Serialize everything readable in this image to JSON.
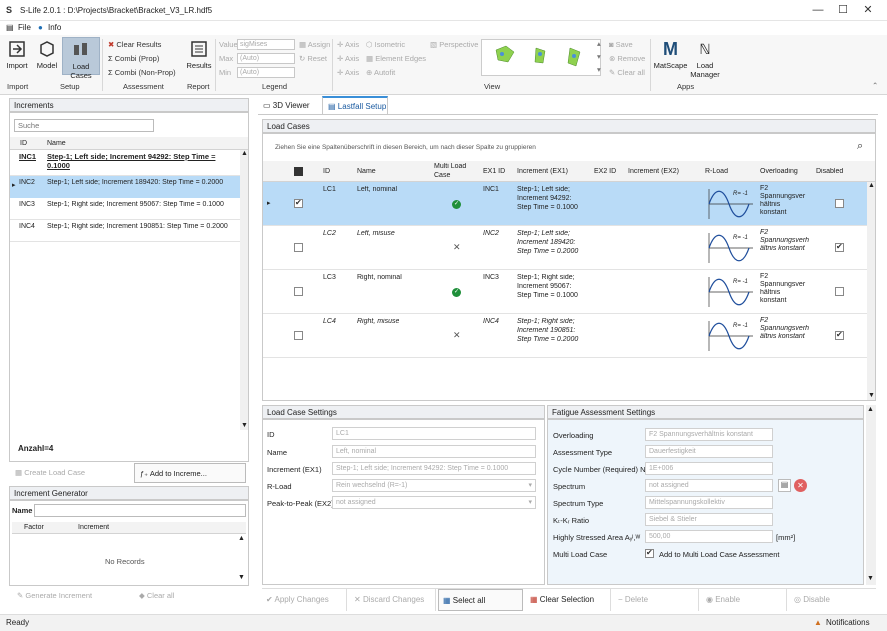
{
  "window": {
    "title": "S-Life 2.0.1 : D:\\Projects\\Bracket\\Bracket_V3_LR.hdf5",
    "app_icon": "S"
  },
  "menu": {
    "file": "File",
    "info": "Info"
  },
  "ribbon": {
    "import": "Import",
    "model": "Model",
    "load_cases": "Load Cases",
    "clear_results": "Clear Results",
    "combi_prop": "Combi (Prop)",
    "combi_nonprop": "Combi (Non-Prop)",
    "results": "Results",
    "value_label": "Value",
    "value_val": "sigMises",
    "max_label": "Max",
    "max_val": "(Auto)",
    "min_label": "Min",
    "min_val": "(Auto)",
    "assign": "Assign",
    "reset": "Reset",
    "axis1": "Axis",
    "isometric": "Isometric",
    "axis2": "Axis",
    "element_edges": "Element Edges",
    "axis3": "Axis",
    "autofit": "Autofit",
    "perspective": "Perspective",
    "save": "Save",
    "remove": "Remove",
    "clear_all": "Clear all",
    "matscape": "MatScape",
    "load_manager": "Load Manager",
    "groups": {
      "import": "Import",
      "setup": "Setup",
      "assessment": "Assessment",
      "report": "Report",
      "legend": "Legend",
      "view": "View",
      "apps": "Apps"
    }
  },
  "increments": {
    "title": "Increments",
    "search_placeholder": "Suche",
    "col_id": "ID",
    "col_name": "Name",
    "rows": [
      {
        "id": "INC1",
        "name": "Step-1; Left side; Increment     94292: Step Time = 0.1000"
      },
      {
        "id": "INC2",
        "name": "Step-1; Left side; Increment    189420: Step Time = 0.2000"
      },
      {
        "id": "INC3",
        "name": "Step-1; Right side; Increment     95067: Step Time = 0.1000"
      },
      {
        "id": "INC4",
        "name": "Step-1; Right side; Increment    190851: Step Time = 0.2000"
      }
    ],
    "count": "Anzahl=4",
    "create_load_case": "Create Load Case",
    "add_to_increment": "Add to Increme..."
  },
  "increment_generator": {
    "title": "Increment Generator",
    "name_label": "Name",
    "col_factor": "Factor",
    "col_increment": "Increment",
    "no_records": "No Records",
    "generate": "Generate Increment",
    "clear_all": "Clear all"
  },
  "tabs": {
    "viewer": "3D Viewer",
    "setup": "Lastfall Setup"
  },
  "load_cases": {
    "title": "Load Cases",
    "group_hint": "Ziehen Sie eine Spaltenüberschrift in diesen Bereich, um nach dieser Spalte zu gruppieren",
    "headers": {
      "id": "ID",
      "name": "Name",
      "multi": "Multi Load Case",
      "ex1id": "EX1 ID",
      "inc_ex1": "Increment (EX1)",
      "ex2id": "EX2 ID",
      "inc_ex2": "Increment (EX2)",
      "rload": "R-Load",
      "overloading": "Overloading",
      "disabled": "Disabled"
    },
    "rows": [
      {
        "id": "LC1",
        "name": "Left, nominal",
        "ex1": "INC1",
        "inc1": "Step-1; Left side;",
        "inc2": "Increment    94292:",
        "inc3": "Step Time =   0.1000",
        "r": "R= -1",
        "ov1": "F2",
        "ov2": "Spannungsver",
        "ov3": "hältnis",
        "ov4": "konstant"
      },
      {
        "id": "LC2",
        "name": "Left, misuse",
        "ex1": "INC2",
        "inc1": "Step-1; Left side;",
        "inc2": "Increment   189420:",
        "inc3": "Step Time =   0.2000",
        "r": "R= -1",
        "ov1": "F2",
        "ov2": "Spannungsverh",
        "ov3": "ältnis konstant",
        "ov4": ""
      },
      {
        "id": "LC3",
        "name": "Right, nominal",
        "ex1": "INC3",
        "inc1": "Step-1; Right side;",
        "inc2": "Increment    95067:",
        "inc3": "Step Time =   0.1000",
        "r": "R= -1",
        "ov1": "F2",
        "ov2": "Spannungsver",
        "ov3": "hältnis",
        "ov4": "konstant"
      },
      {
        "id": "LC4",
        "name": "Right, misuse",
        "ex1": "INC4",
        "inc1": "Step-1; Right side;",
        "inc2": "Increment   190851:",
        "inc3": "Step Time =   0.2000",
        "r": "R= -1",
        "ov1": "F2",
        "ov2": "Spannungsverh",
        "ov3": "ältnis konstant",
        "ov4": ""
      }
    ],
    "selected_fraction": 0.25
  },
  "lc_settings": {
    "title": "Load Case Settings",
    "id_label": "ID",
    "id_val": "LC1",
    "name_label": "Name",
    "name_val": "Left, nominal",
    "inc_label": "Increment (EX1)",
    "inc_val": "Step-1; Left side; Increment    94292: Step Time =  0.1000",
    "rload_label": "R-Load",
    "rload_val": "Rein wechselnd (R=-1)",
    "p2p_label": "Peak-to-Peak (EX2)",
    "p2p_val": "not assigned"
  },
  "fatigue": {
    "title": "Fatigue Assessment Settings",
    "overloading_label": "Overloading",
    "overloading_val": "F2 Spannungsverhältnis konstant",
    "atype_label": "Assessment Type",
    "atype_val": "Dauerfestigkeit",
    "cycle_label": "Cycle Number (Required) N",
    "cycle_val": "1E+006",
    "spectrum_label": "Spectrum",
    "spectrum_val": "not assigned",
    "stype_label": "Spectrum Type",
    "stype_val": "Mittelspannungskollektiv",
    "ratio_label": "Kₜ-Kᵣ Ratio",
    "ratio_val": "Siebel & Stieler",
    "area_label": "Highly Stressed Area Aᵧᴵ,ᵂ",
    "area_val": "500,00",
    "area_unit": "[mm²]",
    "multi_label": "Multi Load Case",
    "multi_check": "Add to Multi Load Case Assessment"
  },
  "actions": {
    "apply": "Apply Changes",
    "discard": "Discard Changes",
    "select_all": "Select all",
    "clear_sel": "Clear Selection",
    "delete": "Delete",
    "enable": "Enable",
    "disable": "Disable"
  },
  "status": {
    "ready": "Ready",
    "notifications": "Notifications"
  }
}
